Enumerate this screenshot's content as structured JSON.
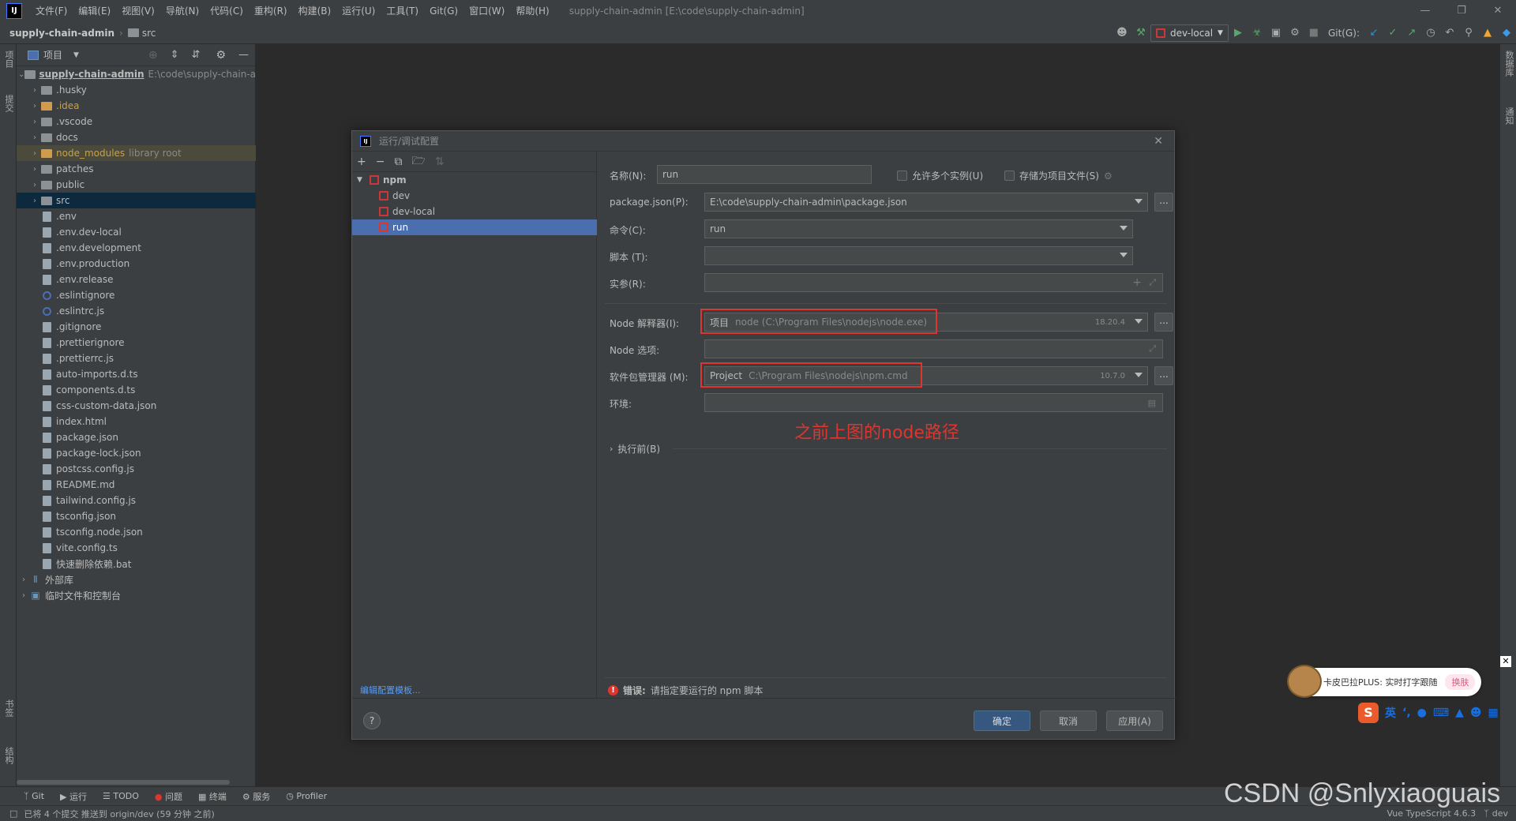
{
  "menubar": {
    "items": [
      "文件(F)",
      "编辑(E)",
      "视图(V)",
      "导航(N)",
      "代码(C)",
      "重构(R)",
      "构建(B)",
      "运行(U)",
      "工具(T)",
      "Git(G)",
      "窗口(W)",
      "帮助(H)"
    ],
    "title": "supply-chain-admin [E:\\code\\supply-chain-admin]"
  },
  "navbar": {
    "project": "supply-chain-admin",
    "folder": "src",
    "run_config": "dev-local",
    "git_label": "Git(G):"
  },
  "left_strip": {
    "tab1": "项目",
    "tab2": "提交",
    "tab3": "书签",
    "tab4": "结构"
  },
  "right_strip": {
    "tab1": "数据库",
    "tab2": "通知"
  },
  "project_panel": {
    "header": "项目",
    "root": {
      "name": "supply-chain-admin",
      "path": "E:\\code\\supply-chain-a"
    },
    "items": [
      {
        "name": ".husky",
        "kind": "folder"
      },
      {
        "name": ".idea",
        "kind": "folder-excl"
      },
      {
        "name": ".vscode",
        "kind": "folder"
      },
      {
        "name": "docs",
        "kind": "folder"
      },
      {
        "name": "node_modules",
        "kind": "folder-excl",
        "hint": "library root"
      },
      {
        "name": "patches",
        "kind": "folder"
      },
      {
        "name": "public",
        "kind": "folder"
      },
      {
        "name": "src",
        "kind": "folder"
      },
      {
        "name": ".env",
        "kind": "file"
      },
      {
        "name": ".env.dev-local",
        "kind": "file"
      },
      {
        "name": ".env.development",
        "kind": "file"
      },
      {
        "name": ".env.production",
        "kind": "file"
      },
      {
        "name": ".env.release",
        "kind": "file"
      },
      {
        "name": ".eslintignore",
        "kind": "circle"
      },
      {
        "name": ".eslintrc.js",
        "kind": "circle"
      },
      {
        "name": ".gitignore",
        "kind": "file"
      },
      {
        "name": ".prettierignore",
        "kind": "file"
      },
      {
        "name": ".prettierrc.js",
        "kind": "file"
      },
      {
        "name": "auto-imports.d.ts",
        "kind": "file"
      },
      {
        "name": "components.d.ts",
        "kind": "file"
      },
      {
        "name": "css-custom-data.json",
        "kind": "file"
      },
      {
        "name": "index.html",
        "kind": "file"
      },
      {
        "name": "package.json",
        "kind": "file"
      },
      {
        "name": "package-lock.json",
        "kind": "file"
      },
      {
        "name": "postcss.config.js",
        "kind": "file"
      },
      {
        "name": "README.md",
        "kind": "file"
      },
      {
        "name": "tailwind.config.js",
        "kind": "file"
      },
      {
        "name": "tsconfig.json",
        "kind": "file"
      },
      {
        "name": "tsconfig.node.json",
        "kind": "file"
      },
      {
        "name": "vite.config.ts",
        "kind": "file"
      },
      {
        "name": "快速删除依赖.bat",
        "kind": "file"
      }
    ],
    "external": "外部库",
    "scratches": "临时文件和控制台"
  },
  "dialog": {
    "title": "运行/调试配置",
    "tree": {
      "group": "npm",
      "children": [
        "dev",
        "dev-local",
        "run"
      ],
      "selected": "run"
    },
    "edit_templates": "编辑配置模板...",
    "name_label": "名称(N):",
    "name_value": "run",
    "allow_parallel": "允许多个实例(U)",
    "store_as_file": "存储为项目文件(S)",
    "package_json_label": "package.json(P):",
    "package_json_value": "E:\\code\\supply-chain-admin\\package.json",
    "command_label": "命令(C):",
    "command_value": "run",
    "scripts_label": "脚本 (T):",
    "scripts_value": "",
    "args_label": "实参(R):",
    "node_interp_label": "Node 解释器(I):",
    "node_interp_kind": "项目",
    "node_interp_path": "node (C:\\Program Files\\nodejs\\node.exe)",
    "node_version": "18.20.4",
    "node_options_label": "Node 选项:",
    "pkg_manager_label": "软件包管理器 (M):",
    "pkg_manager_kind": "Project",
    "pkg_manager_path": "C:\\Program Files\\nodejs\\npm.cmd",
    "pkg_manager_version": "10.7.0",
    "env_label": "环境:",
    "annotation": "之前上图的node路径",
    "before_launch": "执行前(B)",
    "error_label": "错误:",
    "error_text": "请指定要运行的 npm 脚本",
    "ok": "确定",
    "cancel": "取消",
    "apply": "应用(A)",
    "help": "?"
  },
  "bottom_tabs": [
    "Git",
    "运行",
    "TODO",
    "问题",
    "终端",
    "服务",
    "Profiler"
  ],
  "statusbar": {
    "message": "已将 4 个提交 推送到 origin/dev (59 分钟 之前)",
    "lang": "Vue TypeScript 4.6.3",
    "branch": "dev"
  },
  "ime": {
    "promo": "卡皮巴拉PLUS: 实时打字跟随",
    "switch": "换肤",
    "lang": "英"
  },
  "watermark": "CSDN @Snlyxiaoguais",
  "colors": {
    "accent": "#4b6eaf",
    "annotation": "#e0342e",
    "primary_button": "#365880"
  }
}
